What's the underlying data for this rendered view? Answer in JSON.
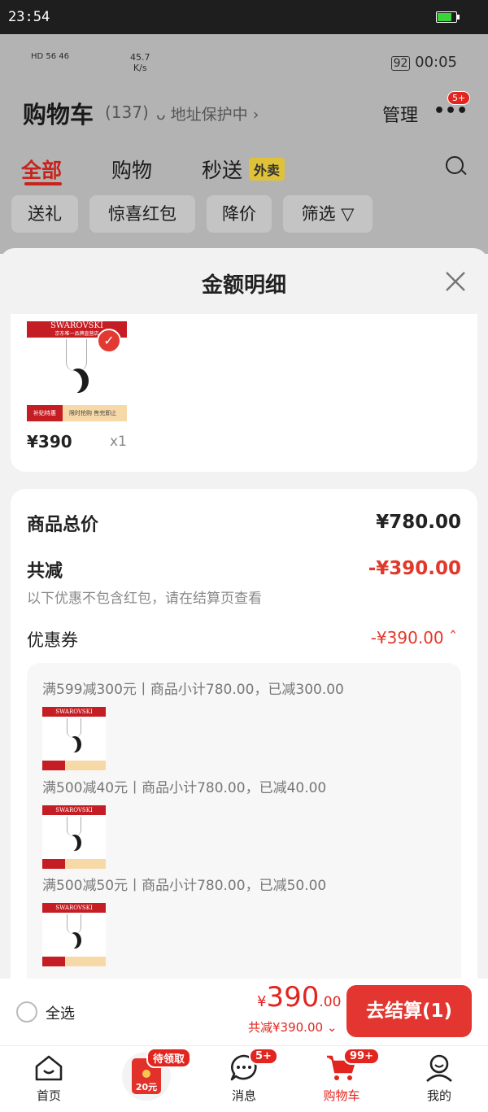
{
  "system": {
    "time": "23:54",
    "battery_color": "#3ad33a"
  },
  "background_app": {
    "status": {
      "net": "HD 56 46",
      "speed_value": "45.7",
      "speed_unit": "K/s",
      "battery": "92",
      "time": "00:05"
    },
    "title": "购物车",
    "count": "(137)",
    "address_protect": "地址保护中",
    "manage": "管理",
    "dots_badge": "5+",
    "tabs": [
      {
        "label": "全部"
      },
      {
        "label": "购物"
      },
      {
        "label": "秒送"
      }
    ],
    "waimai": "外卖",
    "chips": [
      {
        "label": "送礼"
      },
      {
        "label": "惊喜红包"
      },
      {
        "label": "降价"
      },
      {
        "label": "筛选"
      }
    ]
  },
  "sheet": {
    "title": "金额明细",
    "product": {
      "brand": "SWAROVSKI",
      "subtitle": "京东唯一品牌直营店",
      "tag": "补贴特惠",
      "promo": "限时抢购 售完即止",
      "price": "¥390",
      "qty": "x1"
    },
    "summary": {
      "goods_total_label": "商品总价",
      "goods_total_value": "¥780.00",
      "discount_label": "共减",
      "discount_value": "-¥390.00",
      "note": "以下优惠不包含红包，请在结算页查看",
      "coupon_label": "优惠券",
      "coupon_value": "-¥390.00",
      "coupons": [
        {
          "text": "满599减300元丨商品小计780.00，已减300.00"
        },
        {
          "text": "满500减40元丨商品小计780.00，已减40.00"
        },
        {
          "text": "满500减50元丨商品小计780.00，已减50.00"
        }
      ]
    }
  },
  "bottom": {
    "select_all": "全选",
    "yen": "¥",
    "amount": "390",
    "decimal": ".00",
    "saved": "共减¥390.00",
    "checkout": "去结算(1)"
  },
  "tabbar": {
    "items": [
      {
        "label": "首页"
      },
      {
        "label": "",
        "badge": "待领取",
        "coupon": "20元"
      },
      {
        "label": "消息",
        "badge": "5+"
      },
      {
        "label": "购物车",
        "badge": "99+"
      },
      {
        "label": "我的"
      }
    ],
    "accent": "#e2251f"
  }
}
